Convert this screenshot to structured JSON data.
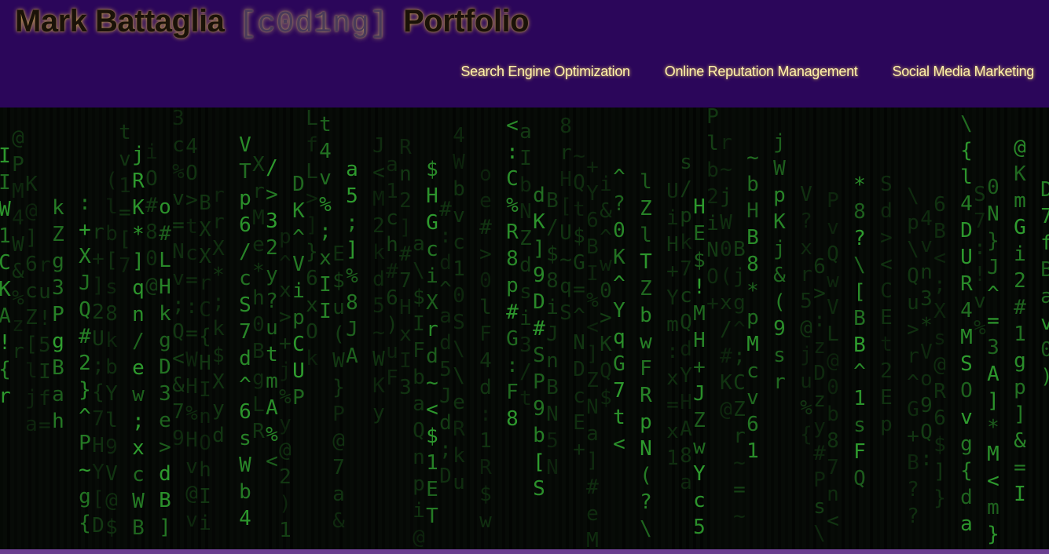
{
  "header": {
    "title_name": "Mark Battaglia",
    "title_coding": "[c0d1ng]",
    "title_portfolio": "Portfolio",
    "background_color": "#2b065a",
    "title_glow_color": "#c9a15a",
    "nav_text_color": "#fff2a8"
  },
  "nav": {
    "items": [
      {
        "label": "Search Engine Optimization"
      },
      {
        "label": "Online Reputation Management"
      },
      {
        "label": "Social Media Marketing"
      }
    ]
  },
  "hero": {
    "image_description": "matrix digital rain",
    "rain_color": "#3dd13d"
  },
  "footer": {
    "bar_color": "#6b3f8f"
  }
}
